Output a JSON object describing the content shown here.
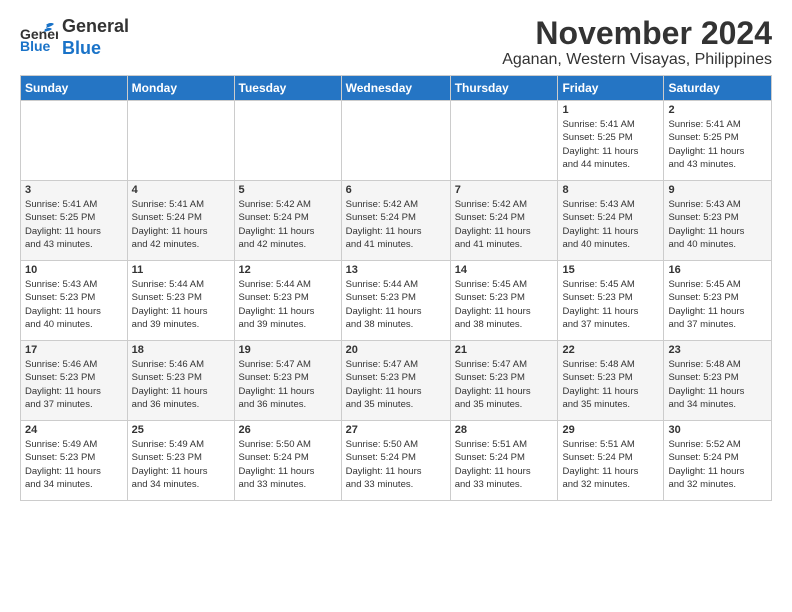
{
  "logo": {
    "line1": "General",
    "line2": "Blue"
  },
  "title": "November 2024",
  "subtitle": "Aganan, Western Visayas, Philippines",
  "weekdays": [
    "Sunday",
    "Monday",
    "Tuesday",
    "Wednesday",
    "Thursday",
    "Friday",
    "Saturday"
  ],
  "weeks": [
    [
      {
        "day": "",
        "info": ""
      },
      {
        "day": "",
        "info": ""
      },
      {
        "day": "",
        "info": ""
      },
      {
        "day": "",
        "info": ""
      },
      {
        "day": "",
        "info": ""
      },
      {
        "day": "1",
        "info": "Sunrise: 5:41 AM\nSunset: 5:25 PM\nDaylight: 11 hours\nand 44 minutes."
      },
      {
        "day": "2",
        "info": "Sunrise: 5:41 AM\nSunset: 5:25 PM\nDaylight: 11 hours\nand 43 minutes."
      }
    ],
    [
      {
        "day": "3",
        "info": "Sunrise: 5:41 AM\nSunset: 5:25 PM\nDaylight: 11 hours\nand 43 minutes."
      },
      {
        "day": "4",
        "info": "Sunrise: 5:41 AM\nSunset: 5:24 PM\nDaylight: 11 hours\nand 42 minutes."
      },
      {
        "day": "5",
        "info": "Sunrise: 5:42 AM\nSunset: 5:24 PM\nDaylight: 11 hours\nand 42 minutes."
      },
      {
        "day": "6",
        "info": "Sunrise: 5:42 AM\nSunset: 5:24 PM\nDaylight: 11 hours\nand 41 minutes."
      },
      {
        "day": "7",
        "info": "Sunrise: 5:42 AM\nSunset: 5:24 PM\nDaylight: 11 hours\nand 41 minutes."
      },
      {
        "day": "8",
        "info": "Sunrise: 5:43 AM\nSunset: 5:24 PM\nDaylight: 11 hours\nand 40 minutes."
      },
      {
        "day": "9",
        "info": "Sunrise: 5:43 AM\nSunset: 5:23 PM\nDaylight: 11 hours\nand 40 minutes."
      }
    ],
    [
      {
        "day": "10",
        "info": "Sunrise: 5:43 AM\nSunset: 5:23 PM\nDaylight: 11 hours\nand 40 minutes."
      },
      {
        "day": "11",
        "info": "Sunrise: 5:44 AM\nSunset: 5:23 PM\nDaylight: 11 hours\nand 39 minutes."
      },
      {
        "day": "12",
        "info": "Sunrise: 5:44 AM\nSunset: 5:23 PM\nDaylight: 11 hours\nand 39 minutes."
      },
      {
        "day": "13",
        "info": "Sunrise: 5:44 AM\nSunset: 5:23 PM\nDaylight: 11 hours\nand 38 minutes."
      },
      {
        "day": "14",
        "info": "Sunrise: 5:45 AM\nSunset: 5:23 PM\nDaylight: 11 hours\nand 38 minutes."
      },
      {
        "day": "15",
        "info": "Sunrise: 5:45 AM\nSunset: 5:23 PM\nDaylight: 11 hours\nand 37 minutes."
      },
      {
        "day": "16",
        "info": "Sunrise: 5:45 AM\nSunset: 5:23 PM\nDaylight: 11 hours\nand 37 minutes."
      }
    ],
    [
      {
        "day": "17",
        "info": "Sunrise: 5:46 AM\nSunset: 5:23 PM\nDaylight: 11 hours\nand 37 minutes."
      },
      {
        "day": "18",
        "info": "Sunrise: 5:46 AM\nSunset: 5:23 PM\nDaylight: 11 hours\nand 36 minutes."
      },
      {
        "day": "19",
        "info": "Sunrise: 5:47 AM\nSunset: 5:23 PM\nDaylight: 11 hours\nand 36 minutes."
      },
      {
        "day": "20",
        "info": "Sunrise: 5:47 AM\nSunset: 5:23 PM\nDaylight: 11 hours\nand 35 minutes."
      },
      {
        "day": "21",
        "info": "Sunrise: 5:47 AM\nSunset: 5:23 PM\nDaylight: 11 hours\nand 35 minutes."
      },
      {
        "day": "22",
        "info": "Sunrise: 5:48 AM\nSunset: 5:23 PM\nDaylight: 11 hours\nand 35 minutes."
      },
      {
        "day": "23",
        "info": "Sunrise: 5:48 AM\nSunset: 5:23 PM\nDaylight: 11 hours\nand 34 minutes."
      }
    ],
    [
      {
        "day": "24",
        "info": "Sunrise: 5:49 AM\nSunset: 5:23 PM\nDaylight: 11 hours\nand 34 minutes."
      },
      {
        "day": "25",
        "info": "Sunrise: 5:49 AM\nSunset: 5:23 PM\nDaylight: 11 hours\nand 34 minutes."
      },
      {
        "day": "26",
        "info": "Sunrise: 5:50 AM\nSunset: 5:24 PM\nDaylight: 11 hours\nand 33 minutes."
      },
      {
        "day": "27",
        "info": "Sunrise: 5:50 AM\nSunset: 5:24 PM\nDaylight: 11 hours\nand 33 minutes."
      },
      {
        "day": "28",
        "info": "Sunrise: 5:51 AM\nSunset: 5:24 PM\nDaylight: 11 hours\nand 33 minutes."
      },
      {
        "day": "29",
        "info": "Sunrise: 5:51 AM\nSunset: 5:24 PM\nDaylight: 11 hours\nand 32 minutes."
      },
      {
        "day": "30",
        "info": "Sunrise: 5:52 AM\nSunset: 5:24 PM\nDaylight: 11 hours\nand 32 minutes."
      }
    ]
  ]
}
